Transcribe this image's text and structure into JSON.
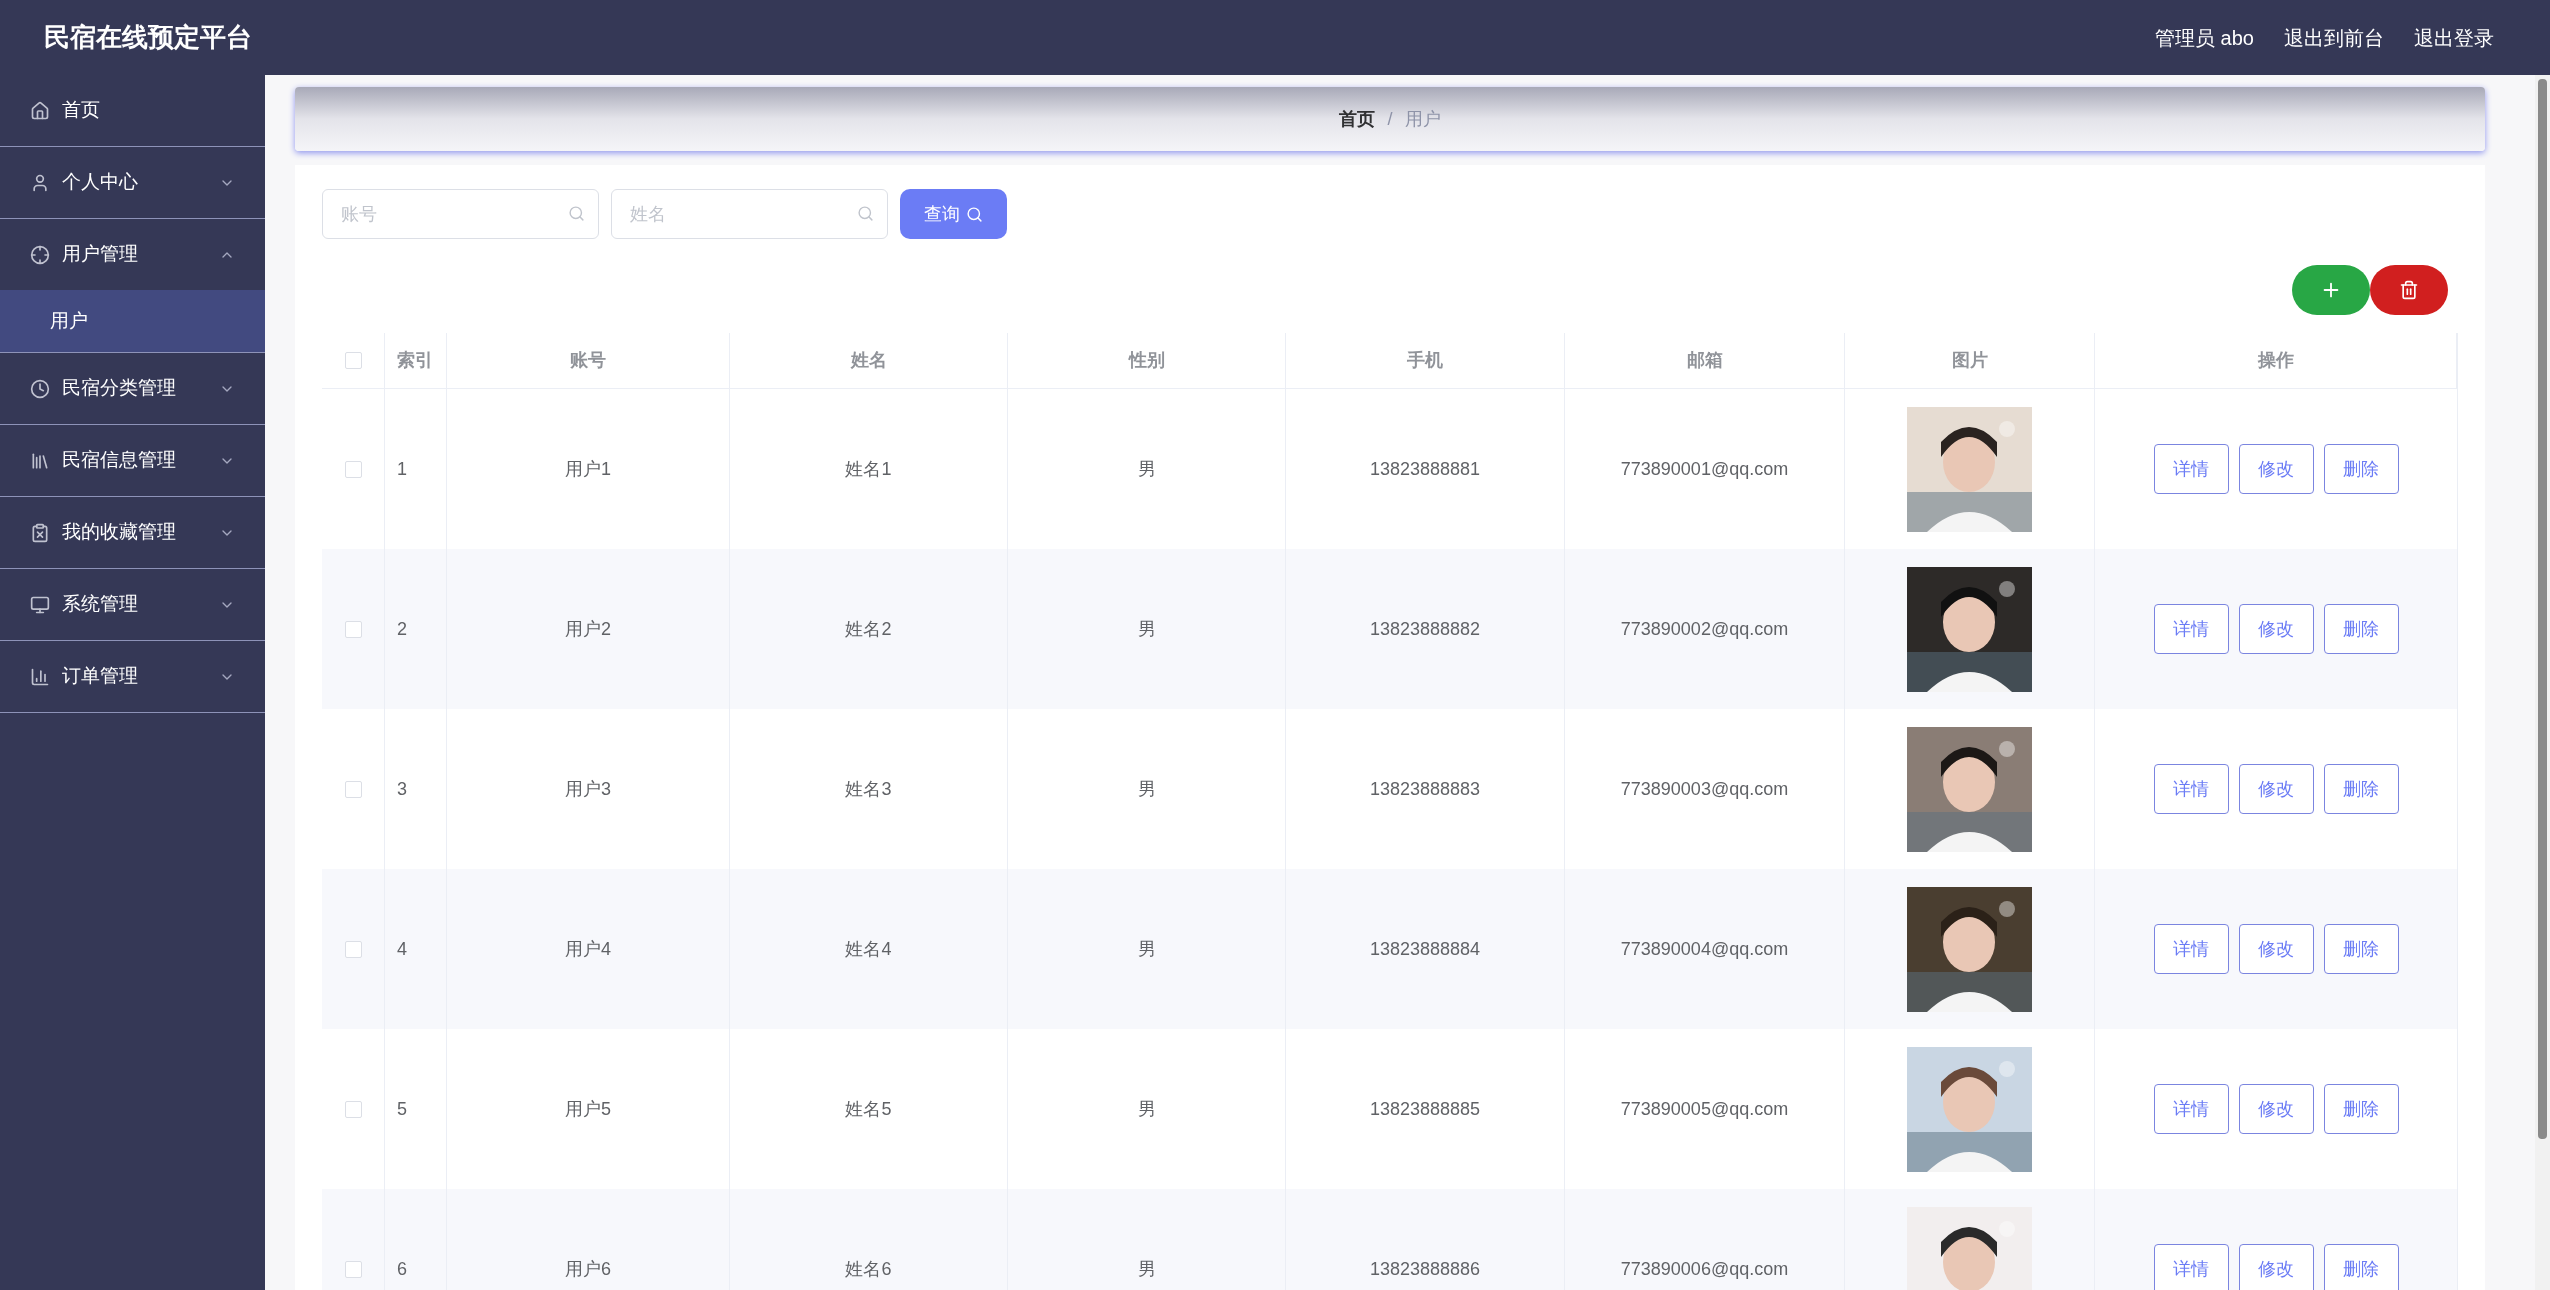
{
  "header": {
    "title": "民宿在线预定平台",
    "links": [
      "管理员 abo",
      "退出到前台",
      "退出登录"
    ]
  },
  "sidebar": {
    "items": [
      {
        "label": "首页",
        "kind": "link"
      },
      {
        "label": "个人中心",
        "kind": "group",
        "expanded": false
      },
      {
        "label": "用户管理",
        "kind": "group",
        "expanded": true,
        "children": [
          {
            "label": "用户",
            "selected": true
          }
        ]
      },
      {
        "label": "民宿分类管理",
        "kind": "group",
        "expanded": false
      },
      {
        "label": "民宿信息管理",
        "kind": "group",
        "expanded": false
      },
      {
        "label": "我的收藏管理",
        "kind": "group",
        "expanded": false
      },
      {
        "label": "系统管理",
        "kind": "group",
        "expanded": false
      },
      {
        "label": "订单管理",
        "kind": "group",
        "expanded": false
      }
    ]
  },
  "breadcrumb": {
    "items": [
      "首页",
      "用户"
    ],
    "separator": "/"
  },
  "search": {
    "fields": [
      {
        "placeholder": "账号"
      },
      {
        "placeholder": "姓名"
      }
    ],
    "button": "查询"
  },
  "table": {
    "header_checked": false,
    "columns": [
      "索引",
      "账号",
      "姓名",
      "性别",
      "手机",
      "邮箱",
      "图片",
      "操作"
    ],
    "rows": [
      {
        "index": "1",
        "account": "用户1",
        "name": "姓名1",
        "gender": "男",
        "phone": "13823888881",
        "email": "773890001@qq.com",
        "checked": false,
        "actions": [
          "详情",
          "修改",
          "删除"
        ]
      },
      {
        "index": "2",
        "account": "用户2",
        "name": "姓名2",
        "gender": "男",
        "phone": "13823888882",
        "email": "773890002@qq.com",
        "checked": false,
        "actions": [
          "详情",
          "修改",
          "删除"
        ]
      },
      {
        "index": "3",
        "account": "用户3",
        "name": "姓名3",
        "gender": "男",
        "phone": "13823888883",
        "email": "773890003@qq.com",
        "checked": false,
        "actions": [
          "详情",
          "修改",
          "删除"
        ]
      },
      {
        "index": "4",
        "account": "用户4",
        "name": "姓名4",
        "gender": "男",
        "phone": "13823888884",
        "email": "773890004@qq.com",
        "checked": false,
        "actions": [
          "详情",
          "修改",
          "删除"
        ]
      },
      {
        "index": "5",
        "account": "用户5",
        "name": "姓名5",
        "gender": "男",
        "phone": "13823888885",
        "email": "773890005@qq.com",
        "checked": false,
        "actions": [
          "详情",
          "修改",
          "删除"
        ]
      },
      {
        "index": "6",
        "account": "用户6",
        "name": "姓名6",
        "gender": "男",
        "phone": "13823888886",
        "email": "773890006@qq.com",
        "checked": false,
        "actions": [
          "详情",
          "修改",
          "删除"
        ]
      }
    ]
  }
}
